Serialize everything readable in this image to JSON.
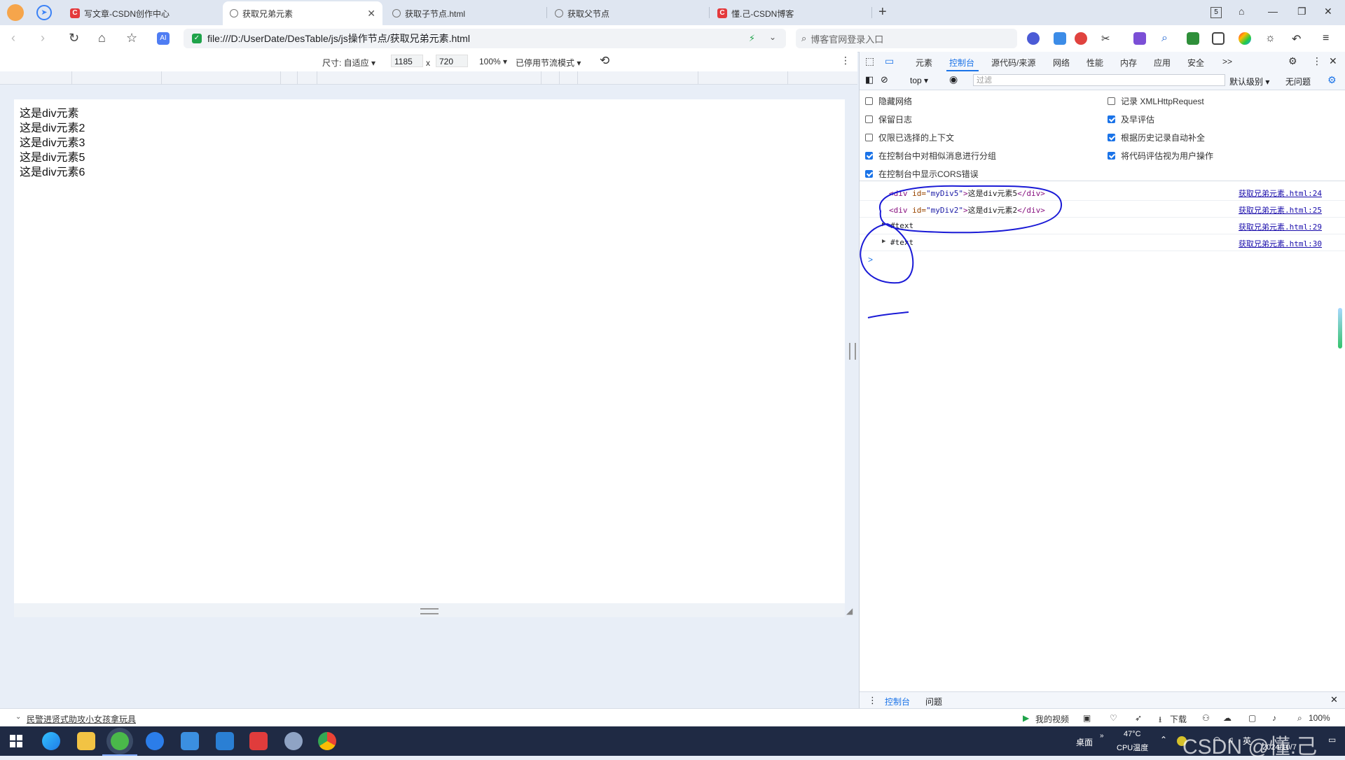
{
  "tabs": [
    {
      "label": "写文章-CSDN创作中心",
      "icon": "csdn-c-icon"
    },
    {
      "label": "获取兄弟元素",
      "icon": "globe-icon"
    },
    {
      "label": "获取子节点.html",
      "icon": "globe-icon"
    },
    {
      "label": "获取父节点",
      "icon": "globe-icon"
    },
    {
      "label": "懂.己-CSDN博客",
      "icon": "csdn-c-icon"
    }
  ],
  "window": {
    "tab_count": "5"
  },
  "address": {
    "url": "file:///D:/UserDate/DesTable/js/js操作节点/获取兄弟元素.html"
  },
  "search": {
    "placeholder": "博客官网登录入口"
  },
  "device": {
    "size_label": "尺寸: 自适应",
    "width": "1185",
    "times": "x",
    "height": "720",
    "zoom": "100%",
    "throttle": "已停用节流模式"
  },
  "page": {
    "lines": [
      "这是div元素",
      "这是div元素2",
      "这是div元素3",
      "这是div元素5",
      "这是div元素6"
    ]
  },
  "devtools": {
    "tabs": [
      "元素",
      "控制台",
      "源代码/来源",
      "网络",
      "性能",
      "内存",
      "应用",
      "安全"
    ],
    "more": ">>",
    "context": "top",
    "filter_placeholder": "过滤",
    "level": "默认级别",
    "issues": "无问题",
    "options_left": [
      {
        "label": "隐藏网络",
        "checked": false
      },
      {
        "label": "保留日志",
        "checked": false
      },
      {
        "label": "仅限已选择的上下文",
        "checked": false
      },
      {
        "label": "在控制台中对相似消息进行分组",
        "checked": true
      },
      {
        "label": "在控制台中显示CORS错误",
        "checked": true
      }
    ],
    "options_right": [
      {
        "label": "记录 XMLHttpRequest",
        "checked": false
      },
      {
        "label": "及早评估",
        "checked": true
      },
      {
        "label": "根据历史记录自动补全",
        "checked": true
      },
      {
        "label": "将代码评估视为用户操作",
        "checked": true
      }
    ],
    "messages": [
      {
        "open": "<div",
        "attr": " id=",
        "value": "\"myDiv5\"",
        "close1": ">",
        "text": "这是div元素5",
        "close2": "</div>",
        "source": "获取兄弟元素.html:24"
      },
      {
        "open": "<div",
        "attr": " id=",
        "value": "\"myDiv2\"",
        "close1": ">",
        "text": "这是div元素2",
        "close2": "</div>",
        "source": "获取兄弟元素.html:25"
      },
      {
        "node": "#text",
        "source": "获取兄弟元素.html:29"
      },
      {
        "node": "#text",
        "source": "获取兄弟元素.html:30"
      }
    ],
    "prompt": ">",
    "drawer_tabs": [
      "控制台",
      "问题"
    ]
  },
  "statusbar": {
    "news": "民警进贤式助攻小女孩拿玩具",
    "video": "我的视频",
    "download": "下载",
    "zoom": "100%"
  },
  "taskbar": {
    "desktop": "桌面",
    "temp": "47°C",
    "temp_label": "CPU温度",
    "ime": "英",
    "date": "2024/10/7",
    "watermark": "CSDN @懂.己"
  },
  "colors": {
    "accent": "#1a73e8",
    "csdn": "#e4393c",
    "annotation": "#1a1ad6"
  }
}
